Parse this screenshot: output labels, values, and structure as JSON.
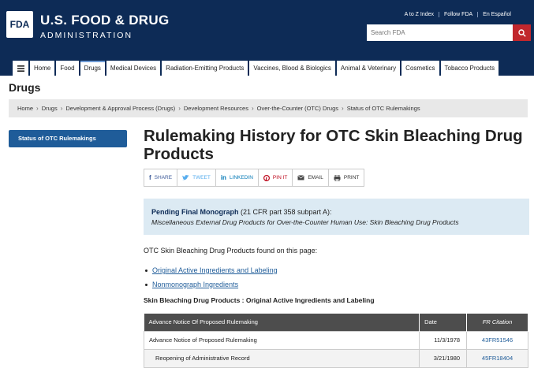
{
  "header": {
    "logo_mark": "FDA",
    "logo_title": "U.S. FOOD & DRUG",
    "logo_subtitle": "ADMINISTRATION",
    "util_links": [
      "A to Z Index",
      "Follow FDA",
      "En Español"
    ],
    "search_placeholder": "Search FDA"
  },
  "nav": {
    "items": [
      {
        "label": "Home"
      },
      {
        "label": "Food"
      },
      {
        "label": "Drugs"
      },
      {
        "label": "Medical Devices"
      },
      {
        "label": "Radiation-Emitting Products"
      },
      {
        "label": "Vaccines, Blood & Biologics"
      },
      {
        "label": "Animal & Veterinary"
      },
      {
        "label": "Cosmetics"
      },
      {
        "label": "Tobacco Products"
      }
    ],
    "active_index": 2
  },
  "page_heading": "Drugs",
  "breadcrumb": [
    "Home",
    "Drugs",
    "Development & Approval Process (Drugs)",
    "Development Resources",
    "Over-the-Counter (OTC) Drugs",
    "Status of OTC Rulemakings"
  ],
  "sidebar": {
    "items": [
      {
        "label": "Status of OTC Rulemakings"
      }
    ]
  },
  "main": {
    "title": "Rulemaking History for OTC Skin Bleaching Drug Products",
    "share": [
      {
        "icon": "f",
        "label": "SHARE"
      },
      {
        "icon": "t",
        "label": "TWEET"
      },
      {
        "icon": "in",
        "label": "LINKEDIN"
      },
      {
        "icon": "p",
        "label": "PIN IT"
      },
      {
        "icon": "m",
        "label": "EMAIL"
      },
      {
        "icon": "pr",
        "label": "PRINT"
      }
    ],
    "notice": {
      "bold": "Pending Final Monograph",
      "ref": " (21 CFR part 358 subpart A):",
      "italic": "Miscellaneous External Drug Products for Over-the-Counter Human Use: Skin Bleaching Drug Products"
    },
    "found_text": "OTC Skin Bleaching Drug Products found on this page:",
    "toc": [
      "Original Active Ingredients and Labeling",
      "Nonmonograph Ingredients"
    ],
    "section_heading": "Skin Bleaching Drug Products : Original Active Ingredients and Labeling",
    "table": {
      "headers": [
        "Advance Notice Of Proposed Rulemaking",
        "Date",
        "FR Citation"
      ],
      "rows": [
        {
          "doc": "Advance Notice of Proposed Rulemaking",
          "date": "11/3/1978",
          "fr": "43FR51546"
        },
        {
          "doc": "Reopening of Administrative Record",
          "date": "3/21/1980",
          "fr": "45FR18404"
        }
      ]
    }
  },
  "colors": {
    "header_bg": "#0d2b56",
    "accent": "#1f5c99",
    "search_button": "#c1272d",
    "notice_bg": "#dceaf3"
  }
}
